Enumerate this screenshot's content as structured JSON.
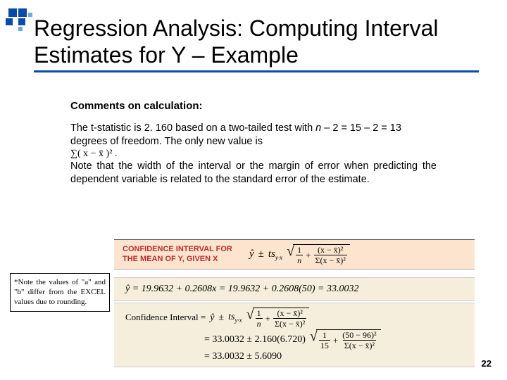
{
  "title": "Regression Analysis: Computing Interval Estimates for Y – Example",
  "subheading": "Comments on calculation:",
  "para1_a": "The t-statistic is 2. 160 based on a two-tailed test with ",
  "para1_b": " – 2 = 15 – 2 = 13 degrees of freedom.  The only new value is",
  "para1_n": "n",
  "sigma_text": "∑( x − x̄ )²  .",
  "para2": "Note that the width of the interval or the margin of error when predicting the dependent variable is related to the standard error of the estimate.",
  "note": "*Note the values of \"a\" and \"b\" differ from the EXCEL values due to rounding.",
  "pink_label": "CONFIDENCE INTERVAL FOR THE MEAN OF Y, GIVEN X",
  "eq_yhat": "ŷ",
  "eq_pm": "±",
  "eq_t": "ts",
  "eq_t_sub": "y·x",
  "eq_one": "1",
  "eq_n": "n",
  "eq_plus": "+",
  "eq_xx_num": "(x − x̄)²",
  "eq_xx_den": "Σ(x − x̄)²",
  "line_eq": "ŷ = 19.9632 + 0.2608x = 19.9632 + 0.2608(50) = 33.0032",
  "ci_label": "Confidence Interval = ",
  "ci_row2_a": "= 33.0032 ± 2.160(6.720)",
  "ci_frac2_num": "1",
  "ci_frac2_den": "15",
  "ci_frac3_num": "(50 − 96)²",
  "ci_frac3_den": "Σ(x − x̄)²",
  "ci_row3": "= 33.0032 ± 5.6090",
  "page_number": "22"
}
